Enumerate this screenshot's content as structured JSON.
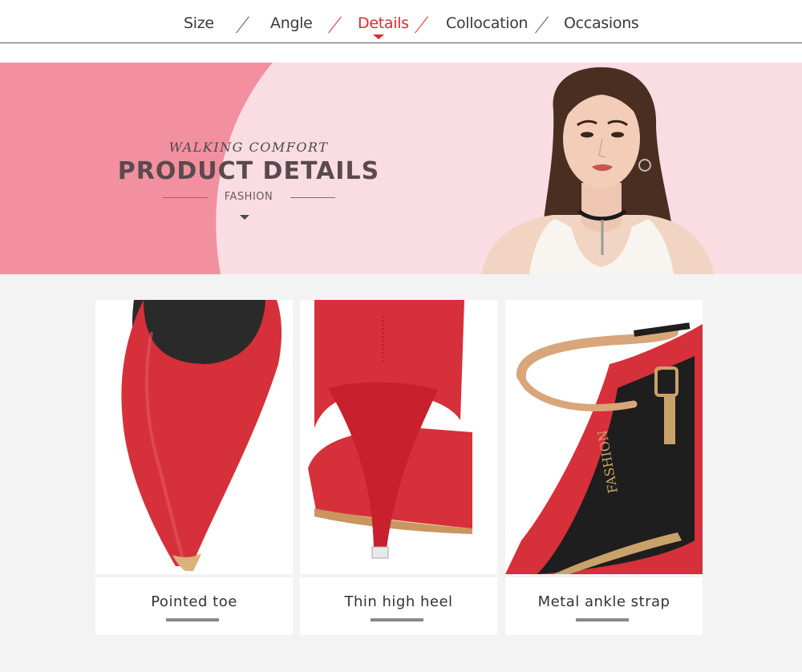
{
  "nav": {
    "items": [
      {
        "label": "Size"
      },
      {
        "label": "Angle"
      },
      {
        "label": "Details",
        "active": true
      },
      {
        "label": "Collocation"
      },
      {
        "label": "Occasions"
      }
    ],
    "accent_color": "#e02a2a"
  },
  "banner": {
    "subtitle": "WALKING COMFORT",
    "title": "PRODUCT DETAILS",
    "tagline": "FASHION",
    "background_color": "#fadde3",
    "shape_color": "#f290a0"
  },
  "products": [
    {
      "label": "Pointed toe",
      "icon": "shoe-toe-photo"
    },
    {
      "label": "Thin high heel",
      "icon": "shoe-heel-photo"
    },
    {
      "label": "Metal ankle strap",
      "icon": "shoe-strap-photo"
    },
    {
      "shoe_print": "FASHION"
    }
  ]
}
